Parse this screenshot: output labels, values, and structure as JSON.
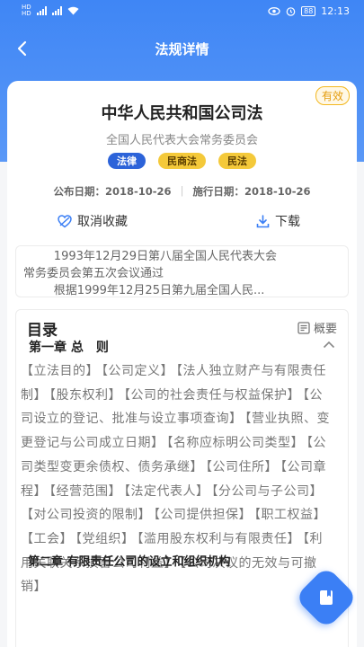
{
  "status_bar": {
    "time": "12:13",
    "battery": "88",
    "network_labels": [
      "HD",
      "HD"
    ]
  },
  "nav": {
    "title": "法规详情"
  },
  "law": {
    "title": "中华人民共和国公司法",
    "validity": "有效",
    "issuer": "全国人民代表大会常务委员会",
    "tags": [
      "法律",
      "民商法",
      "民法"
    ],
    "publish_label": "公布日期：",
    "publish_date": "2018-10-26",
    "effective_label": "施行日期：",
    "effective_date": "2018-10-26"
  },
  "actions": {
    "unfavorite": "取消收藏",
    "download": "下载"
  },
  "summary": {
    "line1": "1993年12月29日第八届全国人民代表大会",
    "line2": "常务委员会第五次会议通过",
    "line3": "根据1999年12月25日第九届全国人民..."
  },
  "toc": {
    "title": "目录",
    "overview": "概要",
    "chapter1": "第一章 总　则",
    "sections": [
      "【立法目的】",
      "【公司定义】",
      "【法人独立财产与有限责任制】",
      "【股东权利】",
      "【公司的社会责任与权益保护】",
      "【公司设立的登记、批准与设立事项查询】",
      "【营业执照、变更登记与公司成立日期】",
      "【名称应标明公司类型】",
      "【公司类型变更余债权、债务承继】",
      "【公司住所】",
      "【公司章程】",
      "【经营范围】",
      "【法定代表人】",
      "【分公司与子公司】",
      "【对公司投资的限制】",
      "【公司提供担保】",
      "【职工权益】",
      "【工会】",
      "【党组织】",
      "【滥用股东权利与有限责任】",
      "【利用关联关系损害公司利益】",
      "【公司决议的无效与可撤销】"
    ],
    "chapter2": "第二章 有限责任公司的设立和组织机构"
  },
  "colors": {
    "primary": "#3f86f5",
    "tag_blue": "#2c63d9",
    "tag_yellow": "#f4c93a",
    "valid_badge": "#f3b81f"
  }
}
